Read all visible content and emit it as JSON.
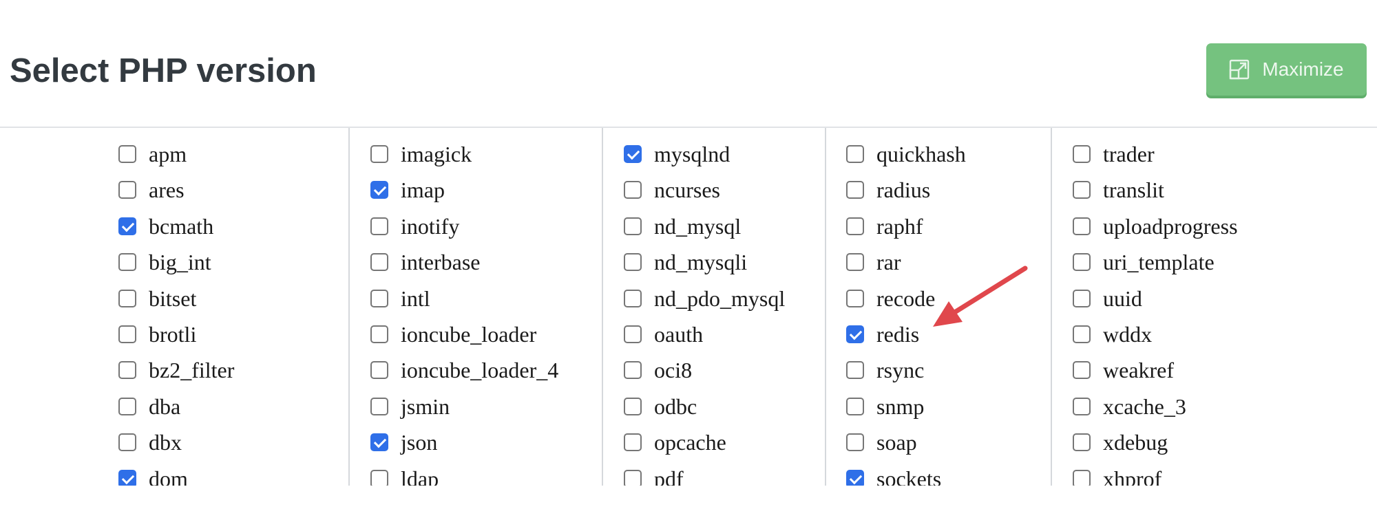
{
  "header": {
    "title": "Select PHP version",
    "maximize_label": "Maximize",
    "maximize_icon": "maximize-icon"
  },
  "colors": {
    "accent_green": "#75c27f",
    "checkbox_checked": "#2f6fe8",
    "arrow_red": "#e0474c"
  },
  "columns": [
    {
      "items": [
        {
          "name": "apm",
          "checked": false
        },
        {
          "name": "ares",
          "checked": false
        },
        {
          "name": "bcmath",
          "checked": true
        },
        {
          "name": "big_int",
          "checked": false
        },
        {
          "name": "bitset",
          "checked": false
        },
        {
          "name": "brotli",
          "checked": false
        },
        {
          "name": "bz2_filter",
          "checked": false
        },
        {
          "name": "dba",
          "checked": false
        },
        {
          "name": "dbx",
          "checked": false
        },
        {
          "name": "dom",
          "checked": true
        }
      ]
    },
    {
      "items": [
        {
          "name": "imagick",
          "checked": false
        },
        {
          "name": "imap",
          "checked": true
        },
        {
          "name": "inotify",
          "checked": false
        },
        {
          "name": "interbase",
          "checked": false
        },
        {
          "name": "intl",
          "checked": false
        },
        {
          "name": "ioncube_loader",
          "checked": false
        },
        {
          "name": "ioncube_loader_4",
          "checked": false
        },
        {
          "name": "jsmin",
          "checked": false
        },
        {
          "name": "json",
          "checked": true
        },
        {
          "name": "ldap",
          "checked": false
        }
      ]
    },
    {
      "items": [
        {
          "name": "mysqlnd",
          "checked": true
        },
        {
          "name": "ncurses",
          "checked": false
        },
        {
          "name": "nd_mysql",
          "checked": false
        },
        {
          "name": "nd_mysqli",
          "checked": false
        },
        {
          "name": "nd_pdo_mysql",
          "checked": false
        },
        {
          "name": "oauth",
          "checked": false
        },
        {
          "name": "oci8",
          "checked": false
        },
        {
          "name": "odbc",
          "checked": false
        },
        {
          "name": "opcache",
          "checked": false
        },
        {
          "name": "pdf",
          "checked": false
        }
      ]
    },
    {
      "items": [
        {
          "name": "quickhash",
          "checked": false
        },
        {
          "name": "radius",
          "checked": false
        },
        {
          "name": "raphf",
          "checked": false
        },
        {
          "name": "rar",
          "checked": false
        },
        {
          "name": "recode",
          "checked": false
        },
        {
          "name": "redis",
          "checked": true
        },
        {
          "name": "rsync",
          "checked": false
        },
        {
          "name": "snmp",
          "checked": false
        },
        {
          "name": "soap",
          "checked": false
        },
        {
          "name": "sockets",
          "checked": true
        }
      ]
    },
    {
      "items": [
        {
          "name": "trader",
          "checked": false
        },
        {
          "name": "translit",
          "checked": false
        },
        {
          "name": "uploadprogress",
          "checked": false
        },
        {
          "name": "uri_template",
          "checked": false
        },
        {
          "name": "uuid",
          "checked": false
        },
        {
          "name": "wddx",
          "checked": false
        },
        {
          "name": "weakref",
          "checked": false
        },
        {
          "name": "xcache_3",
          "checked": false
        },
        {
          "name": "xdebug",
          "checked": false
        },
        {
          "name": "xhprof",
          "checked": false
        }
      ]
    }
  ],
  "annotation": {
    "type": "arrow",
    "points_to": "redis",
    "icon": "arrow-annotation-icon"
  }
}
